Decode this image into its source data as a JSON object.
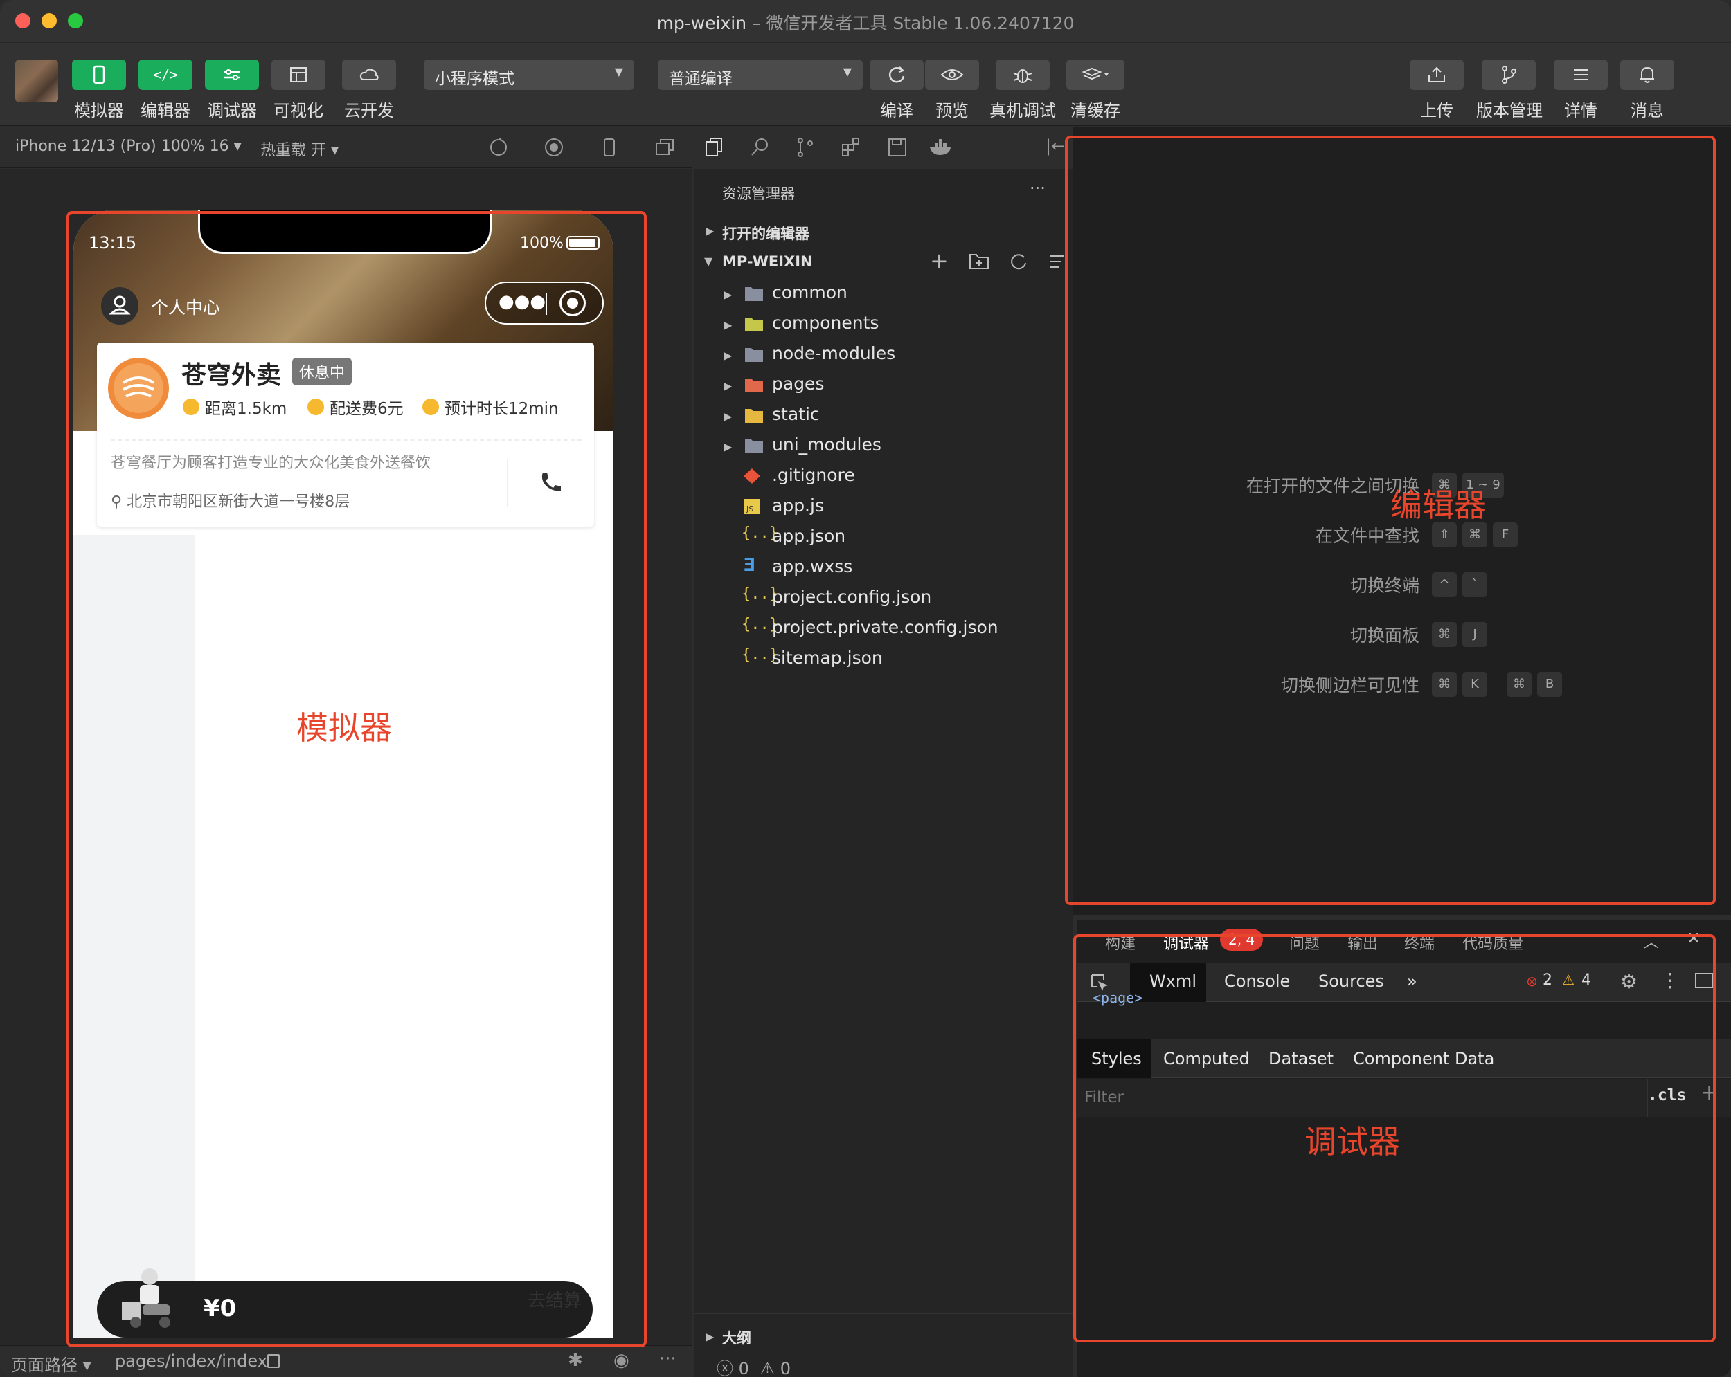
{
  "window": {
    "title": "mp-weixin",
    "subtitle": "– 微信开发者工具 Stable 1.06.2407120",
    "traffic_colors": [
      "#fe5f57",
      "#febc2e",
      "#28c840"
    ]
  },
  "toolbar": {
    "left_buttons": [
      {
        "label": "模拟器",
        "icon": "phone-icon",
        "active": true
      },
      {
        "label": "编辑器",
        "icon": "code-icon",
        "active": true
      },
      {
        "label": "调试器",
        "icon": "sliders-icon",
        "active": true
      },
      {
        "label": "可视化",
        "icon": "layout-icon",
        "active": false
      },
      {
        "label": "云开发",
        "icon": "cloud-icon",
        "active": false
      }
    ],
    "mode_select": "小程序模式",
    "compile_select": "普通编译",
    "center_buttons": [
      {
        "label": "编译",
        "icon": "refresh-icon"
      },
      {
        "label": "预览",
        "icon": "eye-icon"
      },
      {
        "label": "真机调试",
        "icon": "bug-icon"
      },
      {
        "label": "清缓存",
        "icon": "layers-icon"
      }
    ],
    "right_buttons": [
      {
        "label": "上传",
        "icon": "upload-icon"
      },
      {
        "label": "版本管理",
        "icon": "branch-icon"
      },
      {
        "label": "详情",
        "icon": "menu-icon"
      },
      {
        "label": "消息",
        "icon": "bell-icon"
      }
    ]
  },
  "simulator": {
    "device_select": "iPhone 12/13 (Pro) 100% 16 ▾",
    "hot_reload": "热重载 开 ▾",
    "phone": {
      "time": "13:15",
      "battery": "100%",
      "nav_title": "个人中心",
      "shop_name": "苍穹外卖",
      "status_badge": "休息中",
      "distance": "距离1.5km",
      "delivery_fee": "配送费6元",
      "eta": "预计时长12min",
      "description": "苍穹餐厅为顾客打造专业的大众化美食外送餐饮",
      "address": "北京市朝阳区新街大道一号楼8层",
      "cart_price": "¥0",
      "checkout": "去结算"
    },
    "footer_path_label": "页面路径",
    "footer_path": "pages/index/index"
  },
  "explorer": {
    "title": "资源管理器",
    "open_editors": "打开的编辑器",
    "project": "MP-WEIXIN",
    "files": [
      {
        "name": "common",
        "type": "folder",
        "color": "#8a8fa0"
      },
      {
        "name": "components",
        "type": "folder",
        "color": "#c4c74a"
      },
      {
        "name": "node-modules",
        "type": "folder",
        "color": "#8a8fa0"
      },
      {
        "name": "pages",
        "type": "folder",
        "color": "#e2684c"
      },
      {
        "name": "static",
        "type": "folder",
        "color": "#e6b840"
      },
      {
        "name": "uni_modules",
        "type": "folder",
        "color": "#8a8fa0"
      },
      {
        "name": ".gitignore",
        "type": "file",
        "color": "#e8533a"
      },
      {
        "name": "app.js",
        "type": "file",
        "color": "#e8c94a"
      },
      {
        "name": "app.json",
        "type": "file",
        "color": "#e8c94a"
      },
      {
        "name": "app.wxss",
        "type": "file",
        "color": "#4a9ee8"
      },
      {
        "name": "project.config.json",
        "type": "file",
        "color": "#e8c94a"
      },
      {
        "name": "project.private.config.json",
        "type": "file",
        "color": "#e8c94a"
      },
      {
        "name": "sitemap.json",
        "type": "file",
        "color": "#e8c94a"
      }
    ],
    "outline": "大纲",
    "status_errors": "0",
    "status_warnings": "0"
  },
  "editor": {
    "hints": [
      {
        "label": "在打开的文件之间切换",
        "keys": [
          "⌘",
          "1 ~ 9"
        ]
      },
      {
        "label": "在文件中查找",
        "keys": [
          "⇧",
          "⌘",
          "F"
        ]
      },
      {
        "label": "切换终端",
        "keys": [
          "^",
          "`"
        ]
      },
      {
        "label": "切换面板",
        "keys": [
          "⌘",
          "J"
        ]
      },
      {
        "label": "切换侧边栏可见性",
        "keys": [
          "⌘",
          "K",
          "⌘",
          "B"
        ]
      }
    ]
  },
  "debugger": {
    "tabs": [
      "构建",
      "调试器",
      "问题",
      "输出",
      "终端",
      "代码质量"
    ],
    "badge": "2, 4",
    "dev_tabs": [
      "Wxml",
      "Console",
      "Sources",
      "»"
    ],
    "errors": "2",
    "warnings": "4",
    "wxml_snippet": "<page>",
    "style_tabs": [
      "Styles",
      "Computed",
      "Dataset",
      "Component Data"
    ],
    "filter_placeholder": "Filter",
    "cls": ".cls"
  },
  "annotations": {
    "simulator": "模拟器",
    "editor": "编辑器",
    "debugger": "调试器",
    "color": "#e8462c"
  }
}
